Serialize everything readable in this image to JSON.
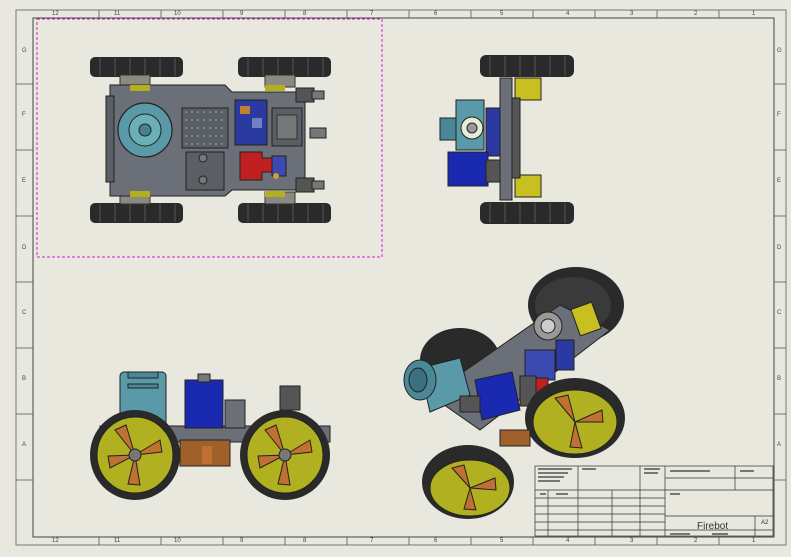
{
  "drawing": {
    "title": "Firebot",
    "sheet_size": "A2",
    "top_zone_labels": [
      "12",
      "11",
      "10",
      "9",
      "8",
      "7",
      "6",
      "5",
      "4",
      "3",
      "2",
      "1"
    ],
    "bottom_zone_labels": [
      "12",
      "11",
      "10",
      "9",
      "8",
      "7",
      "6",
      "5",
      "4",
      "3",
      "2",
      "1"
    ],
    "side_zone_labels": [
      "G",
      "F",
      "E",
      "D",
      "C",
      "B",
      "A"
    ]
  },
  "colors": {
    "sheet_bg": "#e8e8de",
    "border": "#555555",
    "selection": "#d020d0",
    "chassis": "#6a6f78",
    "tire": "#2a2a2a",
    "wheel_hub": "#b0b020",
    "motor_blue": "#1a2ab0",
    "pcb_red": "#c02020",
    "bracket_yellow": "#c8c020",
    "fan_cyan": "#5a9aa8",
    "orange_parts": "#c07030"
  }
}
